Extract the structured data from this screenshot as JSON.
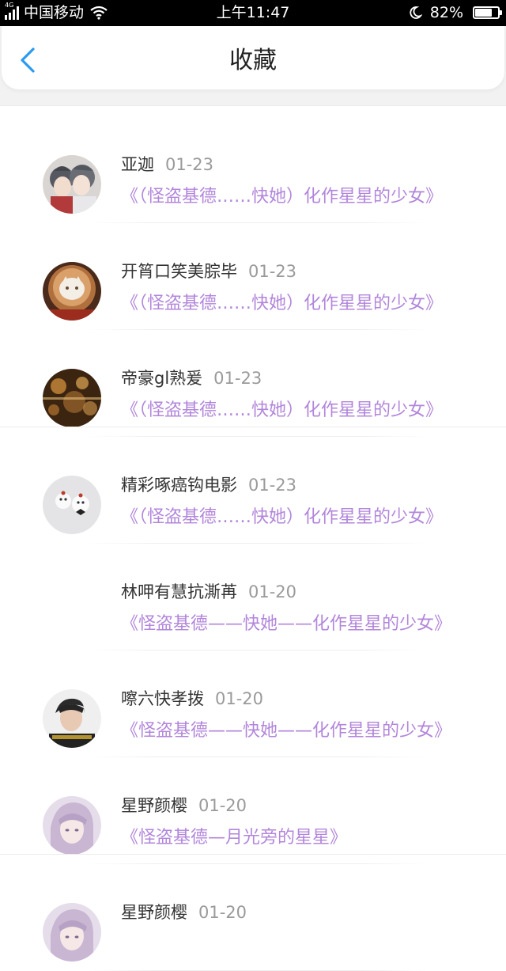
{
  "status_bar": {
    "network": "4G",
    "carrier": "中国移动",
    "time": "上午11:47",
    "battery_text": "82%",
    "battery_level": 0.82
  },
  "header": {
    "back_icon": "chevron-left-icon",
    "title": "收藏"
  },
  "colors": {
    "accent": "#2a9bf0",
    "work_title": "#b286db",
    "date": "#9a9a9a",
    "name": "#333333"
  },
  "items": [
    {
      "name": "亚迦",
      "date": "01-23",
      "work": "《（怪盗基德……快她）化作星星的少女》",
      "avatar": "anime-duo"
    },
    {
      "name": "开筲口笑美腙毕",
      "date": "01-23",
      "work": "《（怪盗基德……快她）化作星星的少女》",
      "avatar": "latte-art"
    },
    {
      "name": "帝豪gl熟爰",
      "date": "01-23",
      "work": "《（怪盗基德……快她）化作星星的少女》",
      "avatar": "amber-bokeh"
    },
    {
      "name": "精彩啄癌钩电影",
      "date": "01-23",
      "work": "《（怪盗基德……快她）化作星星的少女》",
      "avatar": "white-figurines"
    },
    {
      "name": "林呷有慧抗澌苒",
      "date": "01-20",
      "work": "《怪盗基德——快她——化作星星的少女》",
      "avatar": "none"
    },
    {
      "name": "嚓六快孝拨",
      "date": "01-20",
      "work": "《怪盗基德——快她——化作星星的少女》",
      "avatar": "portrait-photo"
    },
    {
      "name": "星野颜樱",
      "date": "01-20",
      "work": "《怪盗基德—月光旁的星星》",
      "avatar": "anime-lavender"
    },
    {
      "name": "星野颜樱",
      "date": "01-20",
      "work": "",
      "avatar": "anime-lavender"
    }
  ]
}
